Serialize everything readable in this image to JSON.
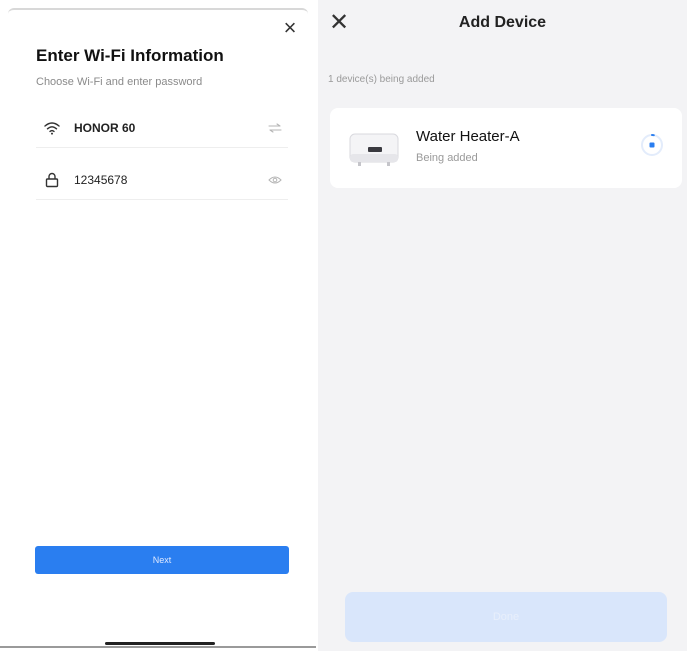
{
  "wifi_screen": {
    "title": "Enter Wi-Fi Information",
    "subtitle": "Choose Wi-Fi and enter password",
    "network_icon": "wifi-icon",
    "network_name": "HONOR 60",
    "switch_icon": "switch-network-icon",
    "lock_icon": "lock-icon",
    "password": "12345678",
    "visibility_icon": "eye-icon",
    "close_icon": "close-icon",
    "next_label": "Next"
  },
  "add_device_screen": {
    "close_icon": "close-icon",
    "title": "Add Device",
    "count_text": "1 device(s) being added",
    "devices": [
      {
        "name": "Water Heater-A",
        "status": "Being added",
        "thumbnail_icon": "water-heater-icon",
        "progress_icon": "progress-spinner-icon"
      }
    ],
    "done_label": "Done"
  },
  "colors": {
    "accent": "#2a7ef0",
    "disabled_button": "#d9e6fb",
    "background_right": "#f3f3f5"
  }
}
